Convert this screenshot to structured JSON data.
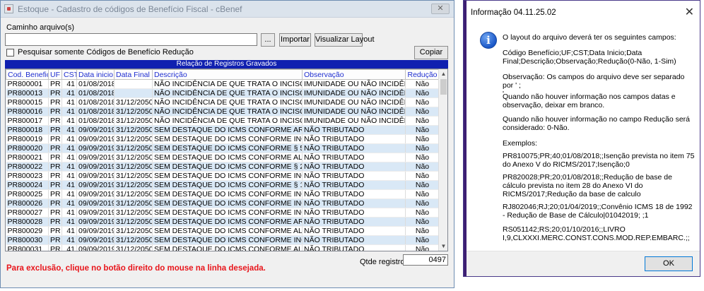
{
  "main_window": {
    "title": "Estoque - Cadastro de códigos de Benefício Fiscal - cBenef",
    "file_path_label": "Caminho arquivo(s)",
    "file_path_value": "",
    "browse_button": "...",
    "import_button": "Importar",
    "view_layout_button": "Visualizar Layout",
    "filter_checkbox_label": "Pesquisar somente Códigos de Benefício Redução",
    "copy_button": "Copiar",
    "grid_title": "Relação de Registros Gravados",
    "columns": [
      "Cod. Beneficio",
      "UF",
      "CST",
      "Data inicio",
      "Data Final",
      "Descrição",
      "Observação",
      "Redução"
    ],
    "rows": [
      [
        "PR800001",
        "PR",
        "41",
        "01/08/2018",
        "",
        "NÃO INCIDÊNCIA DE QUE TRATA O INCISO I DO (C/",
        "IMUNIDADE OU NÃO INCIDÊNCIA",
        "Não"
      ],
      [
        "PR800013",
        "PR",
        "41",
        "01/08/2018",
        "",
        "NÃO INCIDÊNCIA DE QUE TRATA O INCISO XIV DO",
        "IMUNIDADE OU NÃO INCIDÊNCIA",
        "Não"
      ],
      [
        "PR800015",
        "PR",
        "41",
        "01/08/2018",
        "31/12/2050",
        "NÃO INCIDÊNCIA DE QUE TRATA O INCISO I DO PA",
        "IMUNIDADE OU NÃO INCIDÊNCIA",
        "Não"
      ],
      [
        "PR800016",
        "PR",
        "41",
        "01/08/2018",
        "31/12/2050",
        "NÃO INCIDÊNCIA DE QUE TRATA O INCISO II DO PA",
        "IMUNIDADE OU NÃO INCIDÊNCIA",
        "Não"
      ],
      [
        "PR800017",
        "PR",
        "41",
        "01/08/2018",
        "31/12/2050",
        "NÃO INCIDÊNCIA DE QUE TRATA O INCISO XII DO (",
        "IMUNIDADE OU NÃO INCIDÊNCIA",
        "Não"
      ],
      [
        "PR800018",
        "PR",
        "41",
        "09/09/2019",
        "31/12/2050",
        "SEM DESTAQUE DO ICMS CONFORME ART. 140 DO",
        "NÃO TRIBUTADO",
        "Não"
      ],
      [
        "PR800019",
        "PR",
        "41",
        "09/09/2019",
        "31/12/2050",
        "SEM DESTAQUE DO ICMS CONFORME  INCISO II DI",
        "NÃO TRIBUTADO",
        "Não"
      ],
      [
        "PR800020",
        "PR",
        "41",
        "09/09/2019",
        "31/12/2050",
        "SEM DESTAQUE DO ICMS CONFORME § 5º DO ART",
        "NÃO TRIBUTADO",
        "Não"
      ],
      [
        "PR800021",
        "PR",
        "41",
        "09/09/2019",
        "31/12/2050",
        "SEM DESTAQUE DO ICMS CONFORME ALÍNEA B DI",
        "NÃO TRIBUTADO",
        "Não"
      ],
      [
        "PR800022",
        "PR",
        "41",
        "09/09/2019",
        "31/12/2050",
        "SEM DESTAQUE DO ICMS CONFORME § 2º DO ART",
        "NÃO TRIBUTADO",
        "Não"
      ],
      [
        "PR800023",
        "PR",
        "41",
        "09/09/2019",
        "31/12/2050",
        "SEM DESTAQUE DO ICMS CONFORME  INCISO I DC",
        "NÃO TRIBUTADO",
        "Não"
      ],
      [
        "PR800024",
        "PR",
        "41",
        "09/09/2019",
        "31/12/2050",
        "SEM DESTAQUE DO ICMS CONFORME  § 1º DO AR",
        "NÃO TRIBUTADO",
        "Não"
      ],
      [
        "PR800025",
        "PR",
        "41",
        "09/09/2019",
        "31/12/2050",
        "SEM DESTAQUE DO ICMS CONFORME  INCISO II DI",
        "NÃO TRIBUTADO",
        "Não"
      ],
      [
        "PR800026",
        "PR",
        "41",
        "09/09/2019",
        "31/12/2050",
        "SEM DESTAQUE DO ICMS CONFORME INCISO I DO",
        "NÃO TRIBUTADO",
        "Não"
      ],
      [
        "PR800027",
        "PR",
        "41",
        "09/09/2019",
        "31/12/2050",
        "SEM DESTAQUE DO ICMS CONFORME INCISO II DC",
        "NÃO TRIBUTADO",
        "Não"
      ],
      [
        "PR800028",
        "PR",
        "41",
        "09/09/2019",
        "31/12/2050",
        "SEM DESTAQUE DO ICMS CONFORME ART. 419 DO",
        "NÃO TRIBUTADO",
        "Não"
      ],
      [
        "PR800029",
        "PR",
        "41",
        "09/09/2019",
        "31/12/2050",
        "SEM DESTAQUE DO ICMS CONFORME  ALÍNEA B D",
        "NÃO TRIBUTADO",
        "Não"
      ],
      [
        "PR800030",
        "PR",
        "41",
        "09/09/2019",
        "31/12/2050",
        "SEM DESTAQUE DO ICMS CONFORME  INCISO II DI",
        "NÃO TRIBUTADO",
        "Não"
      ],
      [
        "PR800031",
        "PR",
        "41",
        "09/09/2019",
        "31/12/2050",
        "SEM DESTAQUE DO ICMS CONFORME  ALÍNEA A D",
        "NÃO TRIBUTADO",
        "Não"
      ]
    ],
    "record_count_label": "Qtde registros:",
    "record_count_value": "0497",
    "delete_hint": "Para exclusão, clique no botão direito do mouse na linha desejada."
  },
  "dialog": {
    "title": "Informação 04.11.25.02",
    "icon": "info-icon",
    "paragraphs": [
      "O layout do arquivo deverá ter os seguintes campos:",
      "Código Benefício;UF;CST;Data Inicio;Data Final;Descrição;Observação;Redução(0-Não, 1-Sim)",
      "Observação: Os campos do arquivo deve ser separado por ' ;\n'",
      "Quando não houver informação nos campos datas e observação, deixar em branco.",
      "Quando não houver informação no campo Redução será considerado: 0-Não.",
      "Exemplos:",
      "PR810075;PR;40;01/08/2018;;Isenção prevista no item 75 do Anexo V do RICMS/2017;Isenção;0",
      "PR820028;PR;20;01/08/2018;;Redução de base de cálculo prevista no item 28 do Anexo VI do RICMS/2017;Redução da base de calculo",
      "RJ802046;RJ;20;01/04/2019;;Convênio ICMS 18 de 1992 - Redução de Base de Cálculo|01042019; ;1",
      "RS051142;RS;20;01/10/2016;;LIVRO I,9,CLXXXI.MERC.CONST.CONS.MOD.REP.EMBARC.;;"
    ],
    "ok_button": "OK"
  },
  "colors": {
    "grid_header_band": "#1020b0",
    "column_header_text": "#1f2ed0",
    "alt_row": "#d9e8f6",
    "delete_hint": "#e8151b",
    "dialog_band": "#3d1f73"
  }
}
